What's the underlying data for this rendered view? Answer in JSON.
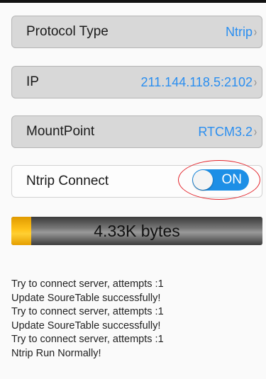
{
  "settings": {
    "protocol": {
      "label": "Protocol Type",
      "value": "Ntrip"
    },
    "ip": {
      "label": "IP",
      "value": "211.144.118.5:2102"
    },
    "mountpoint": {
      "label": "MountPoint",
      "value": "RTCM3.2"
    },
    "chevron": "›"
  },
  "connect": {
    "label": "Ntrip Connect",
    "toggle_text": "ON",
    "on": true
  },
  "progress": {
    "text": "4.33K bytes",
    "fraction": 0.08
  },
  "log": [
    "Try to connect server, attempts :1",
    "Update SoureTable successfully!",
    "Try to connect server, attempts :1",
    "Update SoureTable successfully!",
    "Try to connect server, attempts :1",
    "Ntrip Run Normally!"
  ],
  "colors": {
    "accent": "#2a8ef0",
    "toggle": "#1d8fe6",
    "progress_fill": "#ffc21a",
    "highlight_ring": "#e3242b"
  },
  "icons": {
    "chevron": "chevron-right-icon"
  }
}
